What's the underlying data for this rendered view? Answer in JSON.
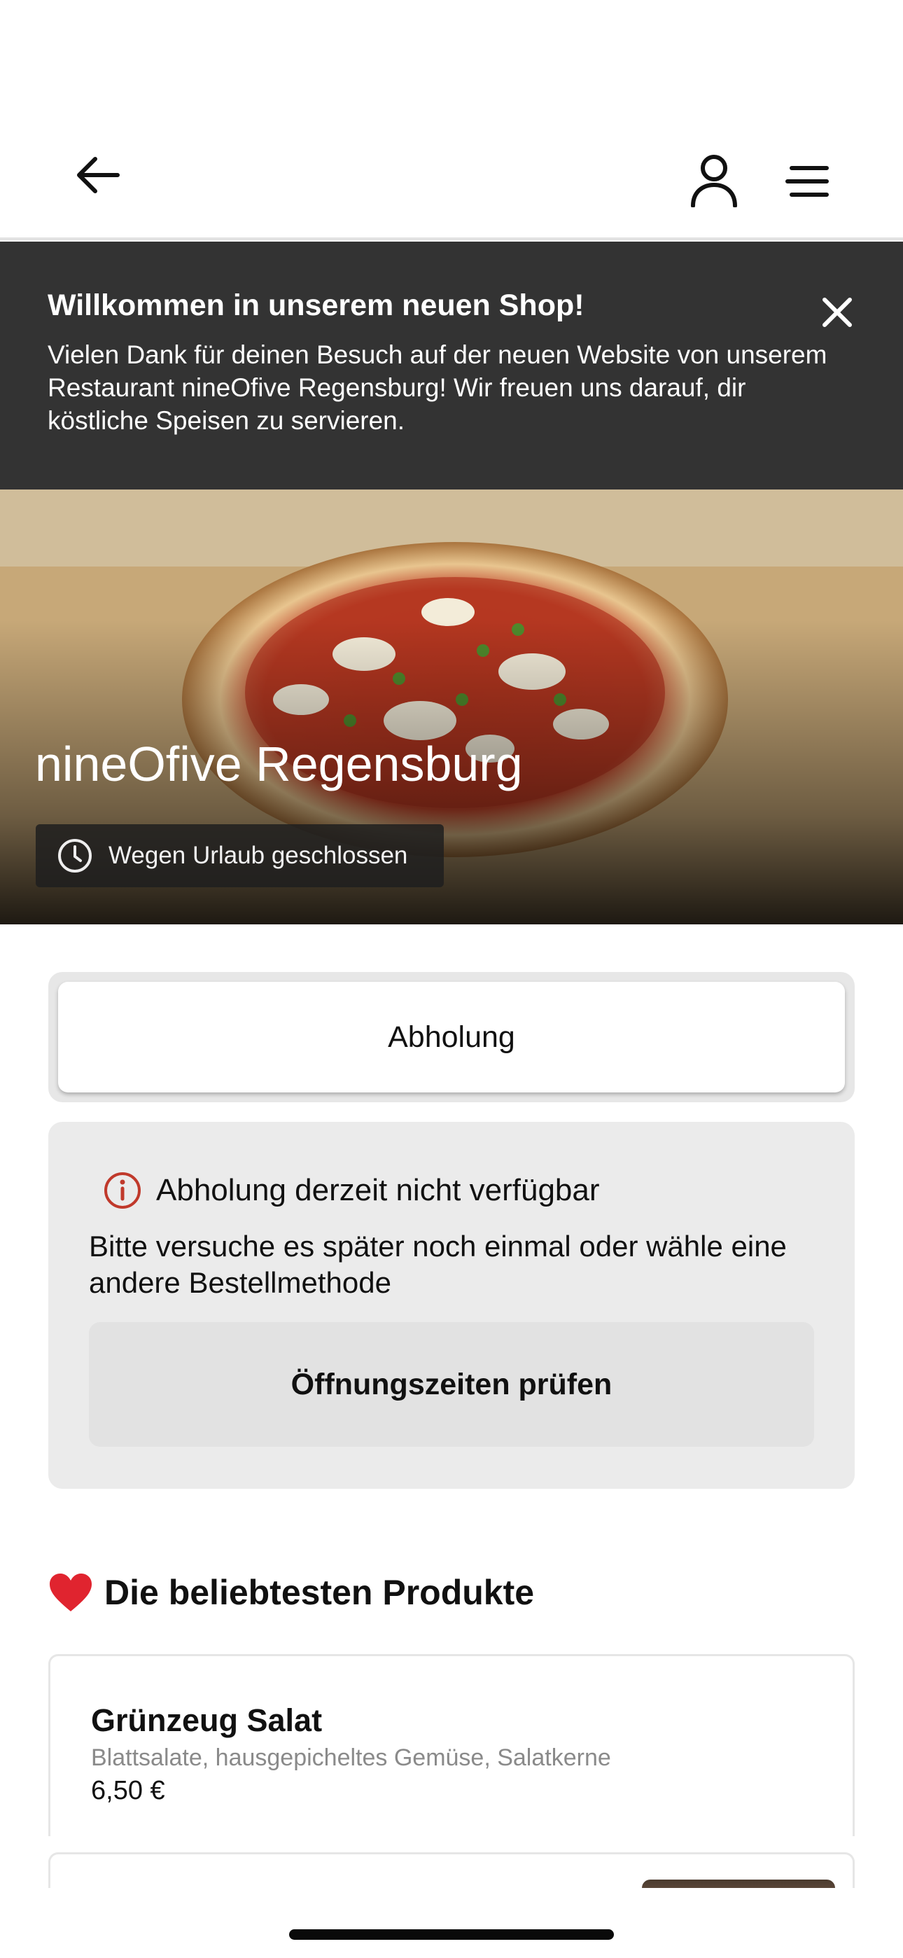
{
  "header": {
    "back_icon": "arrow-left-icon",
    "user_icon": "user-icon",
    "menu_icon": "menu-icon"
  },
  "banner": {
    "title": "Willkommen in unserem neuen Shop!",
    "text": "Vielen Dank für deinen Besuch auf der neuen Website von unserem Restaurant nineOfive Regensburg! Wir freuen uns darauf, dir köstliche Speisen zu servieren.",
    "close_icon": "close-icon",
    "background": "#333333"
  },
  "hero": {
    "restaurant_name": "nineOfive Regensburg",
    "status": "Wegen Urlaub geschlossen",
    "status_icon": "clock-icon"
  },
  "order_method": {
    "selected": "Abholung"
  },
  "notice": {
    "icon": "info-icon",
    "icon_color": "#c0392b",
    "title": "Abholung derzeit nicht verfügbar",
    "text": "Bitte versuche es später noch einmal oder wähle eine andere Bestellmethode",
    "button": "Öffnungszeiten prüfen"
  },
  "popular": {
    "icon": "heart-icon",
    "title": "Die beliebtesten Produkte",
    "products": [
      {
        "name": "Grünzeug Salat",
        "description": "Blattsalate, hausgepicheltes Gemüse, Salatkerne",
        "price": "6,50 €"
      }
    ]
  }
}
